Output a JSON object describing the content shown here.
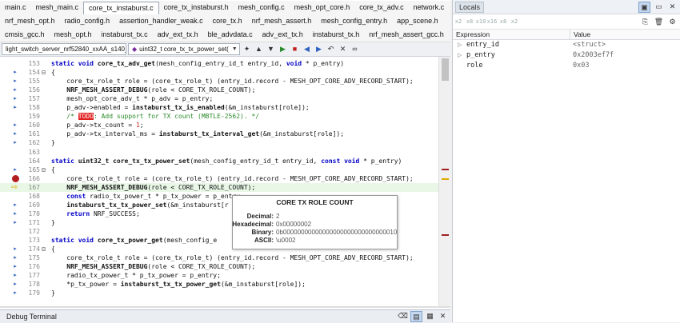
{
  "tabs_row1": [
    "main.c",
    "mesh_main.c",
    "core_tx_instaburst.c",
    "core_tx_instaburst.h",
    "mesh_config.c",
    "mesh_opt_core.h",
    "core_tx_adv.c",
    "network.c"
  ],
  "tabs_row1_active": 2,
  "tabs_row2": [
    "nrf_mesh_opt.h",
    "radio_config.h",
    "assertion_handler_weak.c",
    "core_tx.h",
    "nrf_mesh_assert.h",
    "mesh_config_entry.h",
    "app_scene.h"
  ],
  "tabs_row3": [
    "cmsis_gcc.h",
    "mesh_opt.h",
    "instaburst_tx.c",
    "adv_ext_tx.h",
    "ble_advdata.c",
    "adv_ext_tx.h",
    "instaburst_tx.h",
    "nrf_mesh_assert_gcc.h"
  ],
  "toolbar": {
    "project_combo": "light_switch_server_nrf52840_xxAA_s140_7.2",
    "function_combo": "uint32_t core_tx_tx_power_set(",
    "icon_names": [
      "bookmark-icon",
      "nav-up-icon",
      "nav-down-icon",
      "go-icon",
      "stop-icon",
      "prev-bookmark-icon",
      "next-bookmark-icon",
      "back-icon",
      "clear-bookmarks-icon",
      "glasses-icon"
    ]
  },
  "code_lines": [
    {
      "no": "153",
      "fold": "",
      "gutter": "",
      "html": "<span class='kw'>static void</span> <span class='fn'>core_tx_adv_get</span>(mesh_config_entry_id_t entry_id, <span class='kw'>void</span> * p_entry)"
    },
    {
      "no": "154",
      "fold": "⊟",
      "gutter": "dot",
      "html": "{"
    },
    {
      "no": "155",
      "fold": "",
      "gutter": "dot",
      "html": "    core_tx_role_t role = (core_tx_role_t) (entry_id.record - MESH_OPT_CORE_ADV_RECORD_START);"
    },
    {
      "no": "156",
      "fold": "",
      "gutter": "dot",
      "html": "    <span class='fn'>NRF_MESH_ASSERT_DEBUG</span>(role &lt; CORE_TX_ROLE_COUNT);"
    },
    {
      "no": "157",
      "fold": "",
      "gutter": "dot",
      "html": "    mesh_opt_core_adv_t * p_adv = p_entry;"
    },
    {
      "no": "158",
      "fold": "",
      "gutter": "dot",
      "html": "    p_adv-&gt;enabled = <span class='fn'>instaburst_tx_is_enabled</span>(&amp;m_instaburst[role]);"
    },
    {
      "no": "159",
      "fold": "",
      "gutter": "",
      "html": "    <span class='cm'>/* <span class='todo'>TODO</span>: Add support for TX count (MBTLE-2562). */</span>"
    },
    {
      "no": "160",
      "fold": "",
      "gutter": "dot",
      "html": "    p_adv-&gt;tx_count = <span class='num'>1</span>;"
    },
    {
      "no": "161",
      "fold": "",
      "gutter": "dot",
      "html": "    p_adv-&gt;tx_interval_ms = <span class='fn'>instaburst_tx_interval_get</span>(&amp;m_instaburst[role]);"
    },
    {
      "no": "162",
      "fold": "",
      "gutter": "dot",
      "html": "}"
    },
    {
      "no": "163",
      "fold": "",
      "gutter": "",
      "html": ""
    },
    {
      "no": "164",
      "fold": "",
      "gutter": "",
      "html": "<span class='kw'>static</span> <span class='fn'>uint32_t core_tx_tx_power_set</span>(mesh_config_entry_id_t entry_id, <span class='kw'>const void</span> * p_entry)"
    },
    {
      "no": "165",
      "fold": "⊟",
      "gutter": "dot",
      "html": "{"
    },
    {
      "no": "166",
      "fold": "",
      "gutter": "bp",
      "html": "    core_tx_role_t role = (core_tx_role_t) (entry_id.record - MESH_OPT_CORE_ADV_RECORD_START);"
    },
    {
      "no": "167",
      "fold": "",
      "gutter": "arrow",
      "current": true,
      "html": "    <span class='fn'>NRF_MESH_ASSERT_DEBUG</span>(role &lt; CORE_TX_ROLE_COUNT);"
    },
    {
      "no": "168",
      "fold": "",
      "gutter": "",
      "html": "    <span class='kw'>const</span> radio_tx_power_t * p_tx_power = p_entry;"
    },
    {
      "no": "169",
      "fold": "",
      "gutter": "dot",
      "html": "    <span class='fn'>instaburst_tx_tx_power_set</span>(&amp;m_instaburst[r"
    },
    {
      "no": "170",
      "fold": "",
      "gutter": "dot",
      "html": "    <span class='kw'>return</span> NRF_SUCCESS;"
    },
    {
      "no": "171",
      "fold": "",
      "gutter": "dot",
      "html": "}"
    },
    {
      "no": "172",
      "fold": "",
      "gutter": "",
      "html": ""
    },
    {
      "no": "173",
      "fold": "",
      "gutter": "",
      "html": "<span class='kw'>static void</span> <span class='fn'>core_tx_power_get</span>(mesh_config_e"
    },
    {
      "no": "174",
      "fold": "⊟",
      "gutter": "dot",
      "html": "{"
    },
    {
      "no": "175",
      "fold": "",
      "gutter": "dot",
      "html": "    core_tx_role_t role = (core_tx_role_t) (entry_id.record - MESH_OPT_CORE_ADV_RECORD_START);"
    },
    {
      "no": "176",
      "fold": "",
      "gutter": "dot",
      "html": "    <span class='fn'>NRF_MESH_ASSERT_DEBUG</span>(role &lt; CORE_TX_ROLE_COUNT);"
    },
    {
      "no": "177",
      "fold": "",
      "gutter": "dot",
      "html": "    radio_tx_power_t * p_tx_power = p_entry;"
    },
    {
      "no": "178",
      "fold": "",
      "gutter": "dot",
      "html": "    *p_tx_power = <span class='fn'>instaburst_tx_tx_power_get</span>(&amp;m_instaburst[role]);"
    },
    {
      "no": "179",
      "fold": "",
      "gutter": "dot",
      "html": "}"
    }
  ],
  "tooltip": {
    "title": "CORE TX ROLE COUNT",
    "rows": [
      {
        "key": "Decimal:",
        "value": "2"
      },
      {
        "key": "Hexadecimal:",
        "value": "0x00000002"
      },
      {
        "key": "Binary:",
        "value": "0b00000000000000000000000000000010"
      },
      {
        "key": "ASCII:",
        "value": "\\u0002"
      }
    ]
  },
  "debug_terminal": {
    "title": "Debug Terminal"
  },
  "locals": {
    "title": "Locals",
    "format_buttons": [
      "x2",
      "x8",
      "x10",
      "x16",
      "x8",
      "x2"
    ],
    "columns": {
      "expression": "Expression",
      "value": "Value"
    },
    "rows": [
      {
        "expander": "▷",
        "name": "entry_id",
        "value": "<struct>"
      },
      {
        "expander": "▷",
        "name": "p_entry",
        "value": "0x2003ef7f"
      },
      {
        "expander": "",
        "name": "role",
        "value": "0x03"
      }
    ]
  }
}
